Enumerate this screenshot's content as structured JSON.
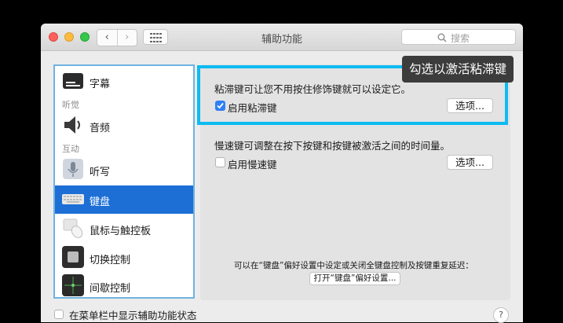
{
  "window": {
    "title": "辅助功能",
    "search_placeholder": "搜索",
    "nav_back": "‹",
    "nav_forward": "›"
  },
  "sidebar": {
    "items": [
      {
        "label": "字幕",
        "icon": "captions-icon"
      },
      {
        "label": "音频",
        "icon": "speaker-icon"
      },
      {
        "label": "听写",
        "icon": "microphone-icon"
      },
      {
        "label": "键盘",
        "icon": "keyboard-icon",
        "selected": true
      },
      {
        "label": "鼠标与触控板",
        "icon": "mouse-icon"
      },
      {
        "label": "切换控制",
        "icon": "switch-control-icon"
      },
      {
        "label": "间歇控制",
        "icon": "dwell-control-icon"
      }
    ],
    "headings": {
      "hearing": "听觉",
      "interaction": "互动"
    }
  },
  "panel": {
    "sticky_desc": "粘滞键可让您不用按住修饰键就可以设定它。",
    "sticky_checkbox_label": "启用粘滞键",
    "sticky_checked": true,
    "sticky_options": "选项...",
    "slow_desc": "慢速键可调整在按下按键和按键被激活之间的时间量。",
    "slow_checkbox_label": "启用慢速键",
    "slow_checked": false,
    "slow_options": "选项...",
    "footer_note": "可以在“键盘”偏好设置中设定或关闭全键盘控制及按键重复延迟：",
    "open_keyboard_prefs": "打开“键盘”偏好设置..."
  },
  "callout": {
    "text": "勾选以激活粘滞键"
  },
  "bottom": {
    "checkbox_label": "在菜单栏中显示辅助功能状态",
    "help": "?"
  },
  "colors": {
    "highlight": "#0dbbf1",
    "selection": "#1d6fd6",
    "checkbox_on": "#2f7ff5"
  }
}
